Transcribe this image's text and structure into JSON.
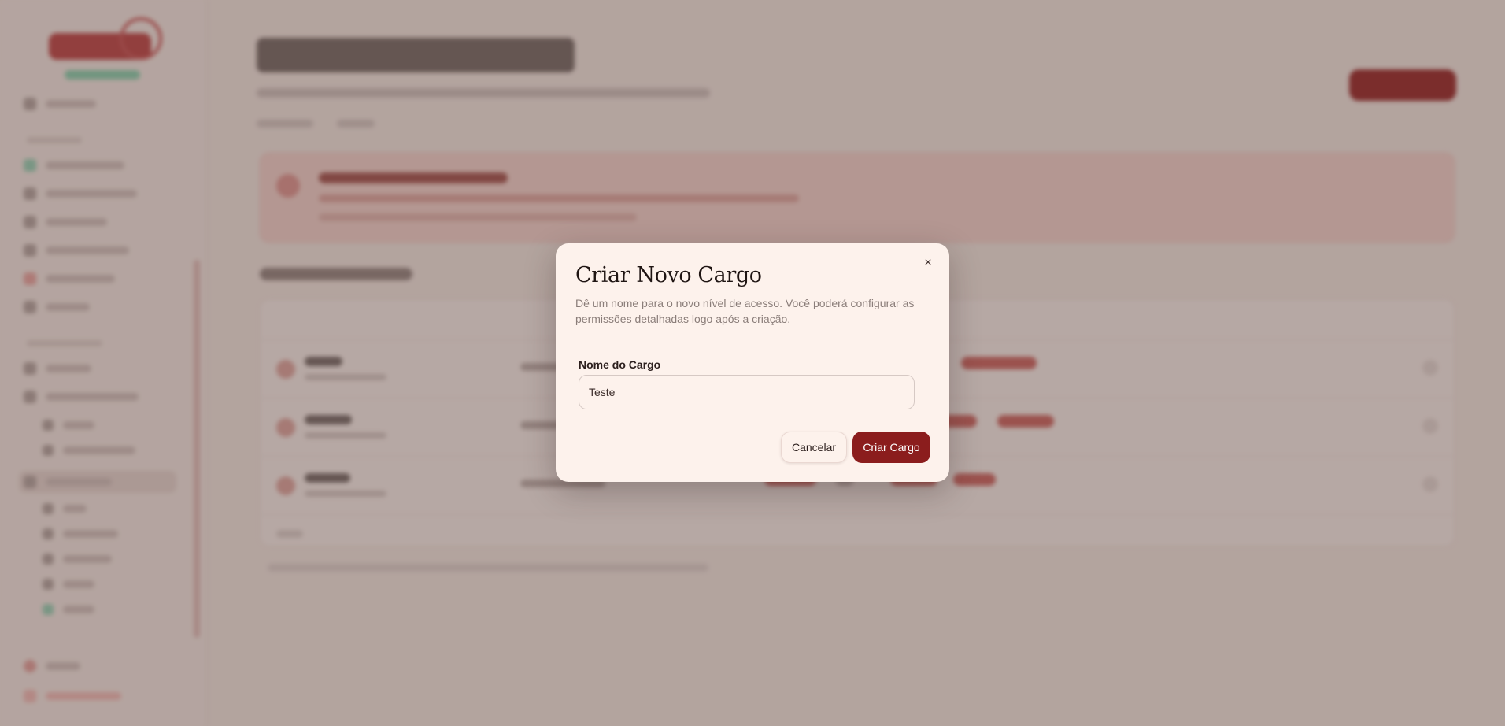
{
  "modal": {
    "title": "Criar Novo Cargo",
    "description": "Dê um nome para o novo nível de acesso. Você poderá configurar as permissões detalhadas logo após a criação.",
    "close_icon": "×",
    "field": {
      "label": "Nome do Cargo",
      "value": "Teste"
    },
    "cancel_label": "Cancelar",
    "submit_label": "Criar Cargo"
  },
  "colors": {
    "accent": "#8b1d1d",
    "modal_bg": "#fdf2ec",
    "page_bg": "#e9ddd6"
  },
  "icons": {
    "close": "close-icon"
  }
}
